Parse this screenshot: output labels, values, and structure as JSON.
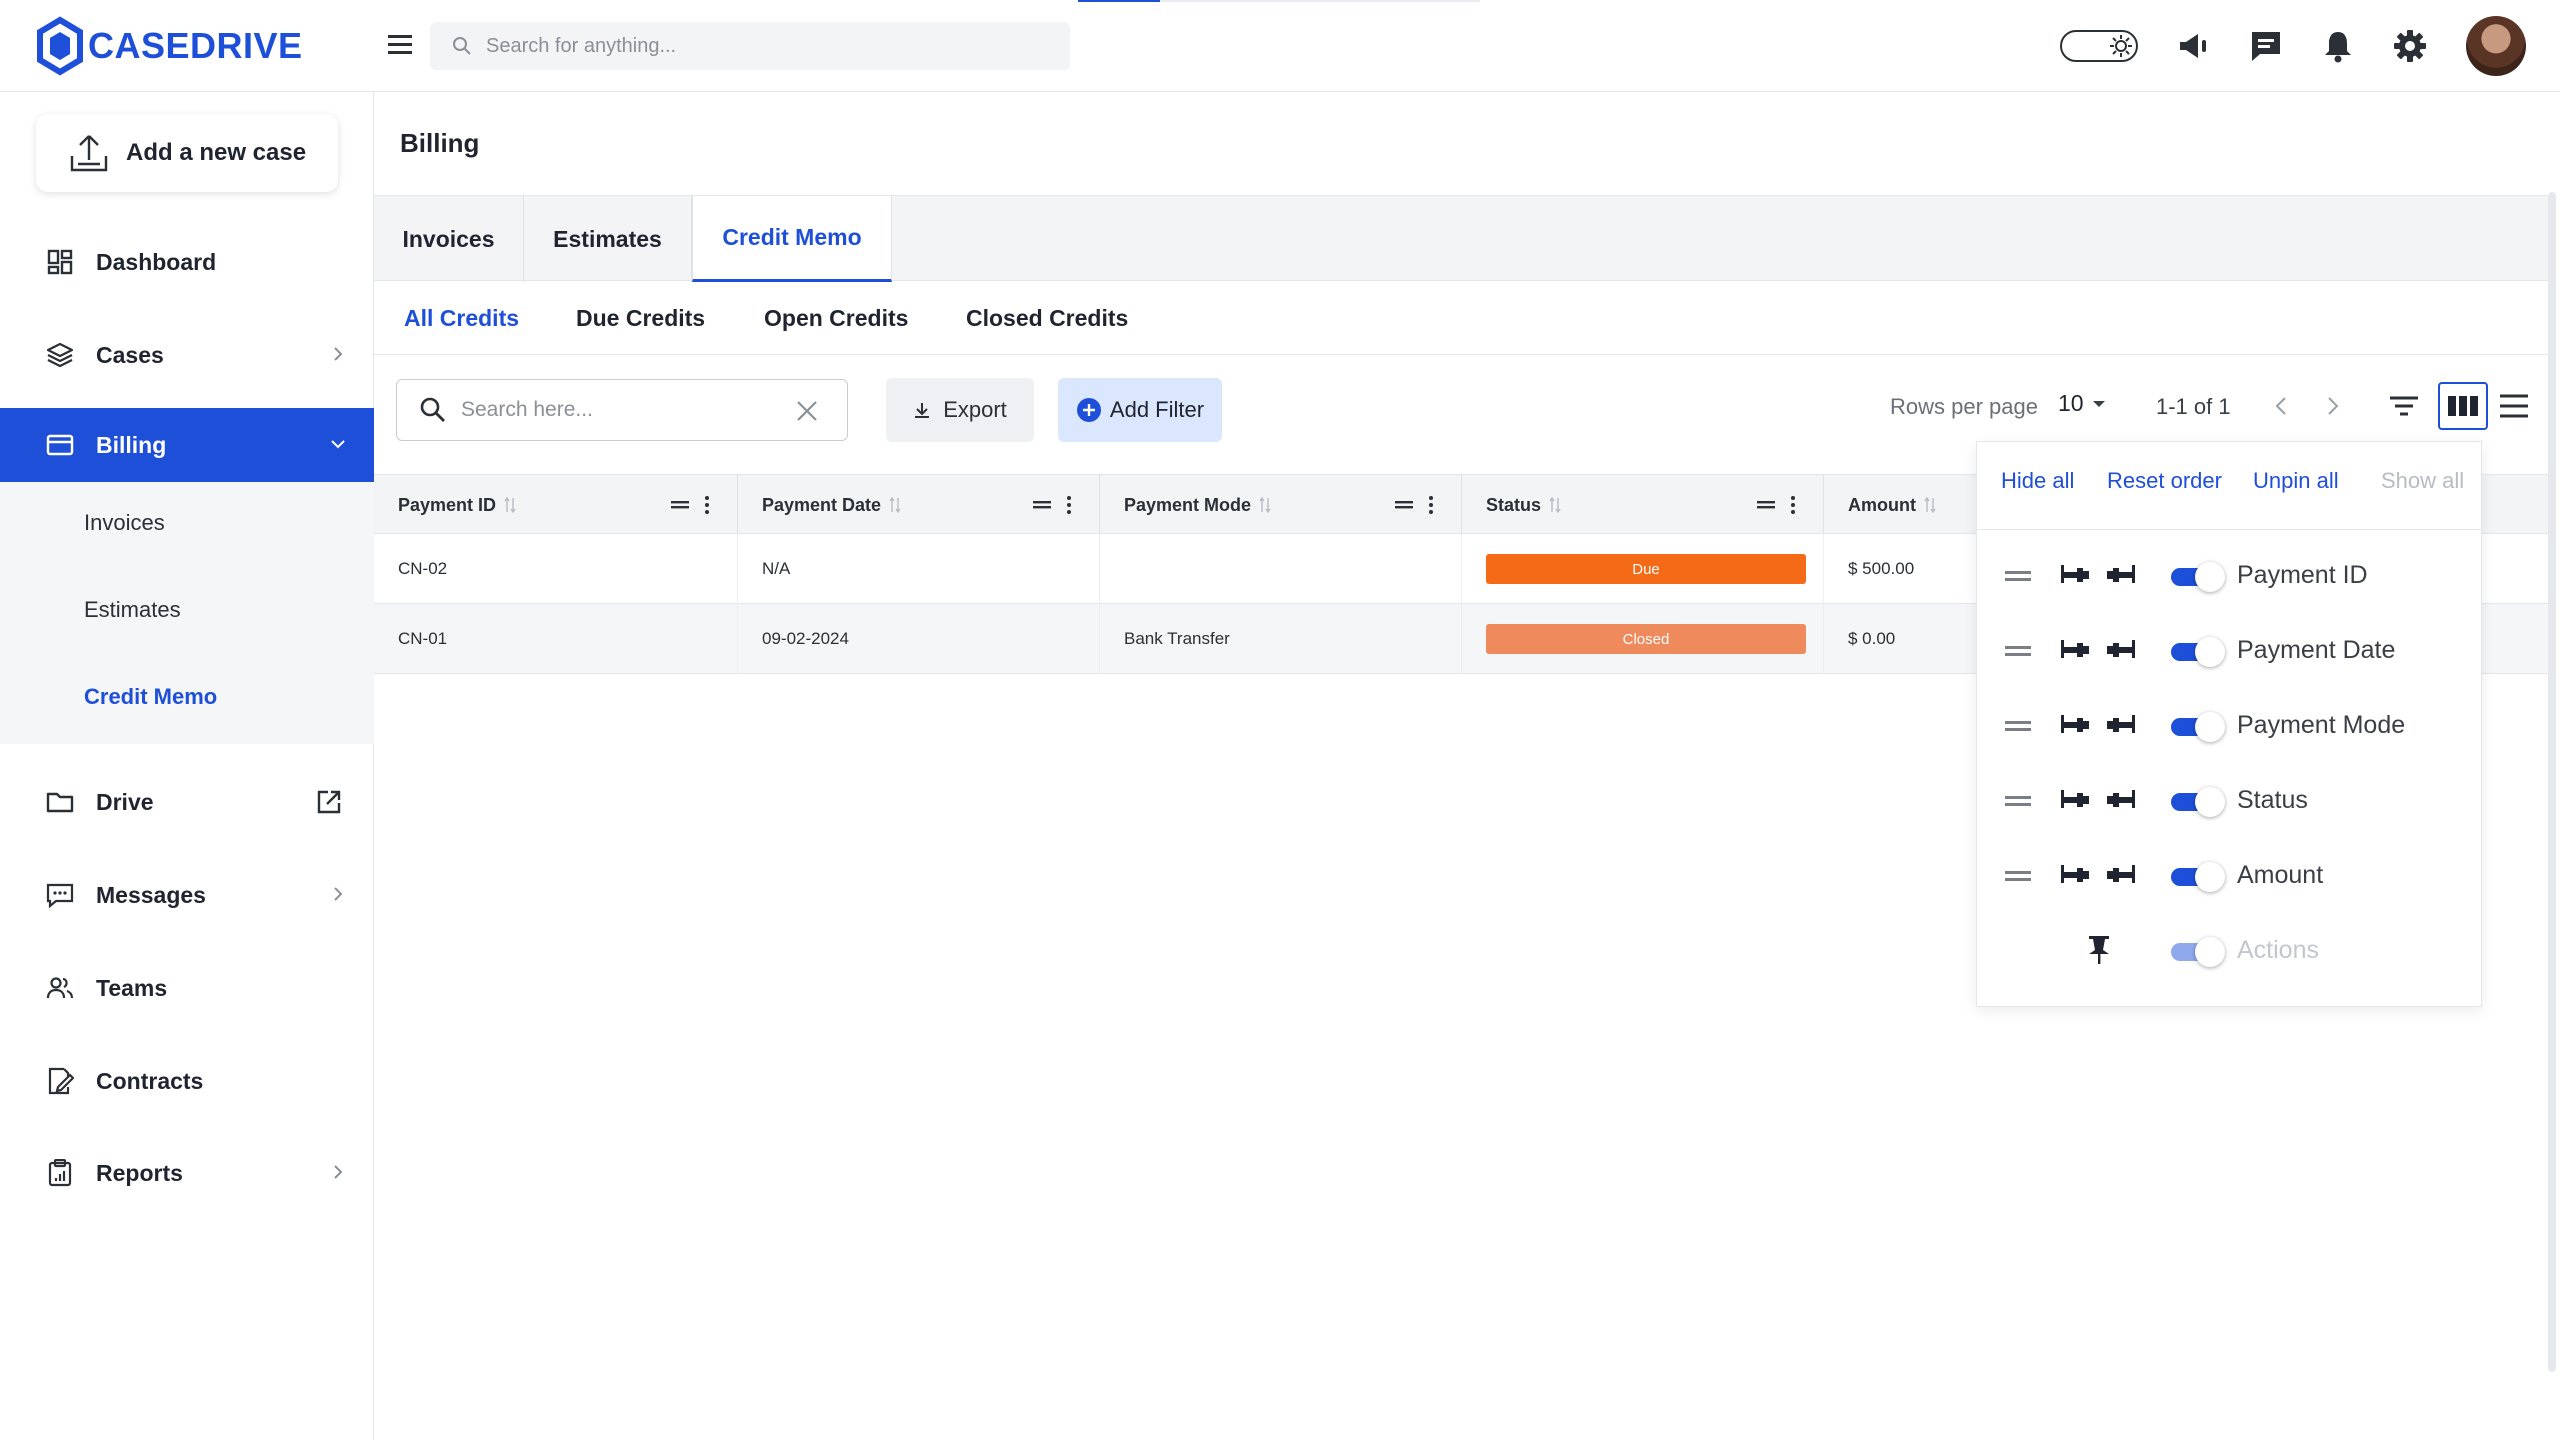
{
  "app": {
    "brand": "CASEDRIVE",
    "search_placeholder": "Search for anything..."
  },
  "sidebar": {
    "add_case_label": "Add a new case",
    "items": [
      {
        "label": "Dashboard"
      },
      {
        "label": "Cases"
      },
      {
        "label": "Billing"
      },
      {
        "label": "Drive"
      },
      {
        "label": "Messages"
      },
      {
        "label": "Teams"
      },
      {
        "label": "Contracts"
      },
      {
        "label": "Reports"
      }
    ],
    "billing_sub": [
      {
        "label": "Invoices"
      },
      {
        "label": "Estimates"
      },
      {
        "label": "Credit Memo"
      }
    ]
  },
  "page": {
    "title": "Billing",
    "tabs": [
      {
        "label": "Invoices"
      },
      {
        "label": "Estimates"
      },
      {
        "label": "Credit Memo"
      }
    ],
    "subtabs": [
      {
        "label": "All Credits"
      },
      {
        "label": "Due Credits"
      },
      {
        "label": "Open Credits"
      },
      {
        "label": "Closed Credits"
      }
    ]
  },
  "toolbar": {
    "search_placeholder": "Search here...",
    "export_label": "Export",
    "add_filter_label": "Add Filter",
    "rows_per_page_label": "Rows per page",
    "rows_per_page_value": "10",
    "range_text": "1-1 of 1"
  },
  "table": {
    "columns": [
      "Payment ID",
      "Payment Date",
      "Payment Mode",
      "Status",
      "Amount"
    ],
    "rows": [
      {
        "payment_id": "CN-02",
        "payment_date": "N/A",
        "payment_mode": "",
        "status": "Due",
        "amount": "$ 500.00"
      },
      {
        "payment_id": "CN-01",
        "payment_date": "09-02-2024",
        "payment_mode": "Bank Transfer",
        "status": "Closed",
        "amount": "$ 0.00"
      }
    ]
  },
  "column_panel": {
    "actions": {
      "hide_all": "Hide all",
      "reset_order": "Reset order",
      "unpin_all": "Unpin all",
      "show_all": "Show all"
    },
    "columns": [
      {
        "label": "Payment ID",
        "visible": true
      },
      {
        "label": "Payment Date",
        "visible": true
      },
      {
        "label": "Payment Mode",
        "visible": true
      },
      {
        "label": "Status",
        "visible": true
      },
      {
        "label": "Amount",
        "visible": true
      },
      {
        "label": "Actions",
        "visible": true
      }
    ]
  },
  "colors": {
    "accent": "#1e4fd8",
    "status_due": "#f56a16",
    "status_closed": "#ee8a5c"
  }
}
